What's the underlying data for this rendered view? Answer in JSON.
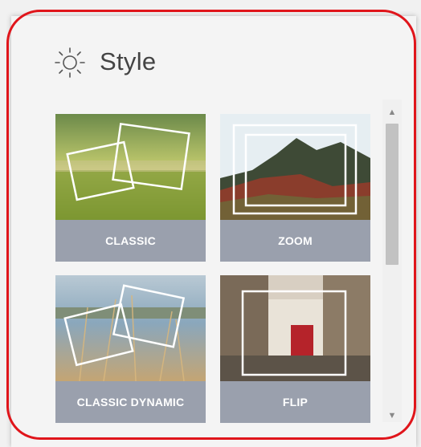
{
  "panel": {
    "title": "Style",
    "icon": "sun-icon"
  },
  "styles": [
    {
      "label": "CLASSIC"
    },
    {
      "label": "ZOOM"
    },
    {
      "label": "CLASSIC DYNAMIC"
    },
    {
      "label": "FLIP"
    }
  ],
  "colors": {
    "highlight_outline": "#e0151b",
    "tile_label_bg": "#9aa0ad",
    "title_text": "#444444"
  }
}
